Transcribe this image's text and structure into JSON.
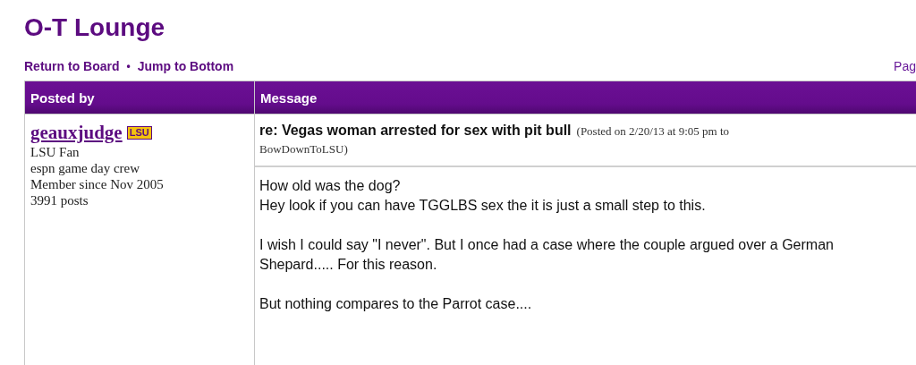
{
  "forum_title": "O-T Lounge",
  "nav_links": [
    "Return to Board",
    "Jump to Bottom"
  ],
  "nav_separator": "•",
  "pagination_label": "Pag",
  "table": {
    "columns": [
      "Posted by",
      "Message"
    ],
    "post": {
      "author": {
        "name": "geauxjudge",
        "badge": "LSU",
        "lines": [
          "LSU Fan",
          "espn game day crew",
          "Member since Nov 2005",
          "3991 posts"
        ]
      },
      "subject": "re: Vegas woman arrested for sex with pit bull",
      "posted_info": [
        "(Posted on 2/20/13 at 9:05 pm to",
        "BowDownToLSU)"
      ],
      "paragraphs": [
        [
          "How old was the dog?",
          "Hey look if you can have TGGLBS sex the it is just a small step to this."
        ],
        [
          "I wish I could say \"I never\". But I once had a case where the couple argued over a German Shepard..... For this reason."
        ],
        [
          "But nothing compares to the Parrot case...."
        ]
      ]
    }
  }
}
